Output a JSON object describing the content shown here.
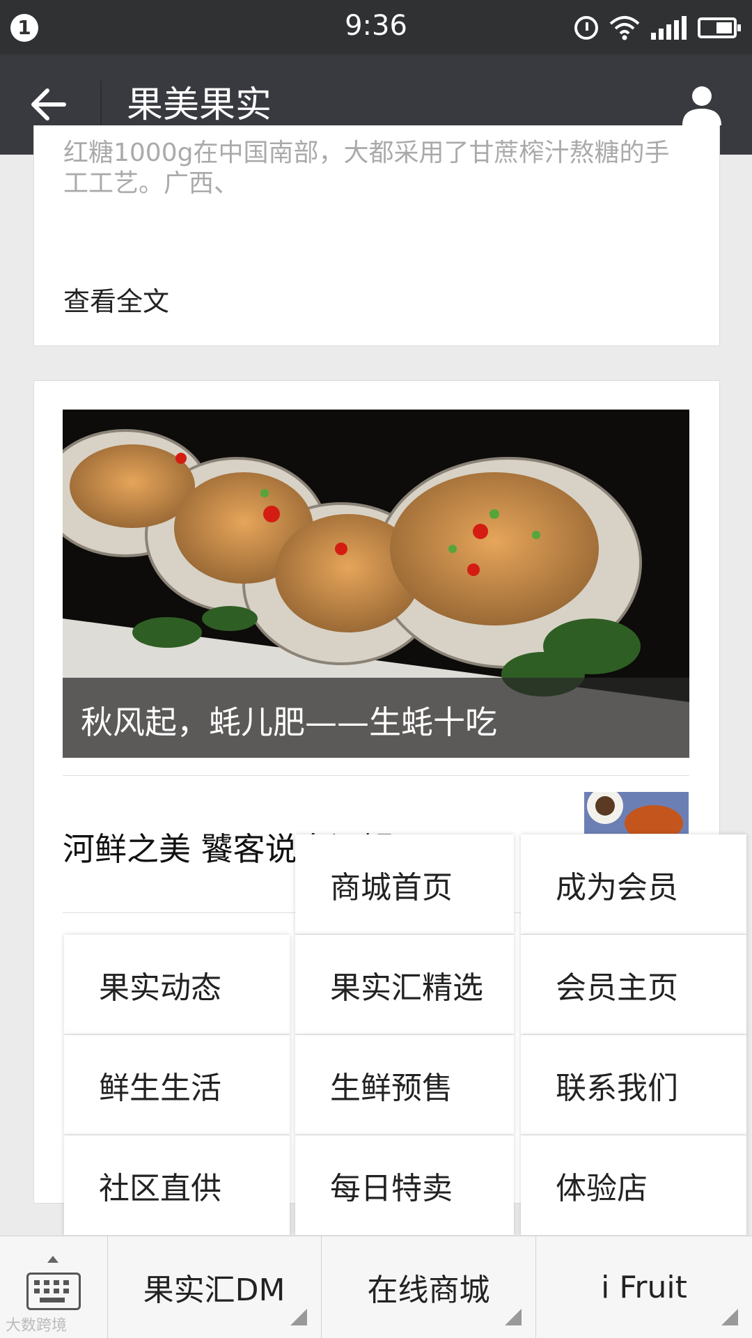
{
  "status_bar": {
    "notification_count": "1",
    "time": "9:36"
  },
  "nav": {
    "title": "果美果实"
  },
  "article1": {
    "excerpt": "红糖1000g在中国南部，大都采用了甘蔗榨汁熬糖的手工工艺。广西、",
    "read_all": "查看全文"
  },
  "article2": {
    "main_caption": "秋风起，蚝儿肥——生蚝十吃",
    "item_title": "河鲜之美  饕客说大闸蟹"
  },
  "menus": {
    "left": [
      "果实动态",
      "鲜生生活",
      "社区直供"
    ],
    "middle": [
      "商城首页",
      "果实汇精选",
      "生鲜预售",
      "每日特卖"
    ],
    "right": [
      "成为会员",
      "会员主页",
      "联系我们",
      "体验店"
    ]
  },
  "bottom_tabs": [
    "果实汇DM",
    "在线商城",
    "i Fruit"
  ],
  "watermark": "大数跨境",
  "colors": {
    "status_bar": "#2f3133",
    "nav_bar": "#393a3f",
    "background": "#ebebeb"
  }
}
